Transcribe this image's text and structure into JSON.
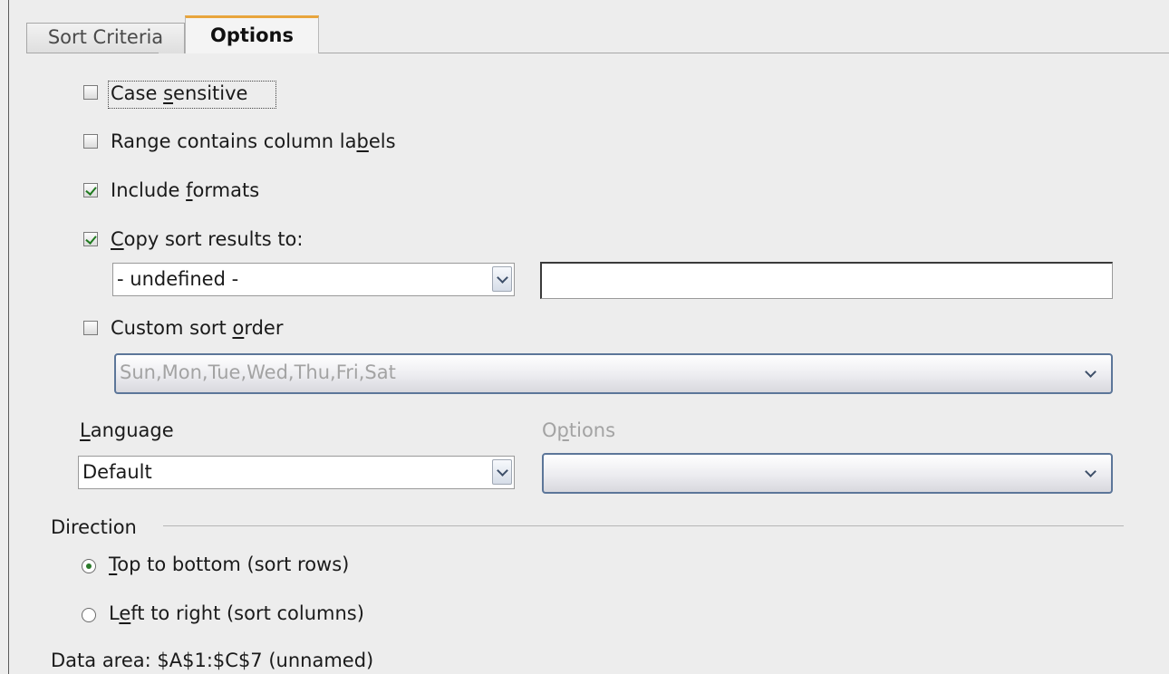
{
  "tabs": [
    {
      "label": "Sort Criteria",
      "active": false
    },
    {
      "label": "Options",
      "active": true
    }
  ],
  "options": {
    "case_sensitive": {
      "pre": "Case ",
      "accel": "s",
      "post": "ensitive",
      "checked": false
    },
    "range_labels": {
      "pre": "Range contains column la",
      "accel": "b",
      "post": "els",
      "checked": false
    },
    "include_formats": {
      "pre": "Include ",
      "accel": "f",
      "post": "ormats",
      "checked": true
    },
    "copy_results": {
      "pre": "",
      "accel": "C",
      "post": "opy sort results to:",
      "checked": true
    },
    "copy_target_value": "- undefined -",
    "copy_target_text": "",
    "custom_order": {
      "pre": "Custom sort ",
      "accel": "o",
      "post": "rder",
      "checked": false
    },
    "custom_order_value": "Sun,Mon,Tue,Wed,Thu,Fri,Sat",
    "language_label": {
      "pre": "",
      "accel": "L",
      "post": "anguage"
    },
    "language_value": "Default",
    "algorithm_label": {
      "pre": "O",
      "accel": "p",
      "post": "tions"
    },
    "algorithm_value": ""
  },
  "direction": {
    "heading": "Direction",
    "top_to_bottom": {
      "pre": "",
      "accel": "T",
      "post": "op to bottom (sort rows)",
      "selected": true
    },
    "left_to_right": {
      "pre": "L",
      "accel": "e",
      "post": "ft to right (sort columns)",
      "selected": false
    }
  },
  "data_area": "Data area: $A$1:$C$7 (unnamed)",
  "colors": {
    "tab_accent": "#e8a53c",
    "check_green": "#1f7a1f",
    "listbox_border": "#5c7699"
  }
}
